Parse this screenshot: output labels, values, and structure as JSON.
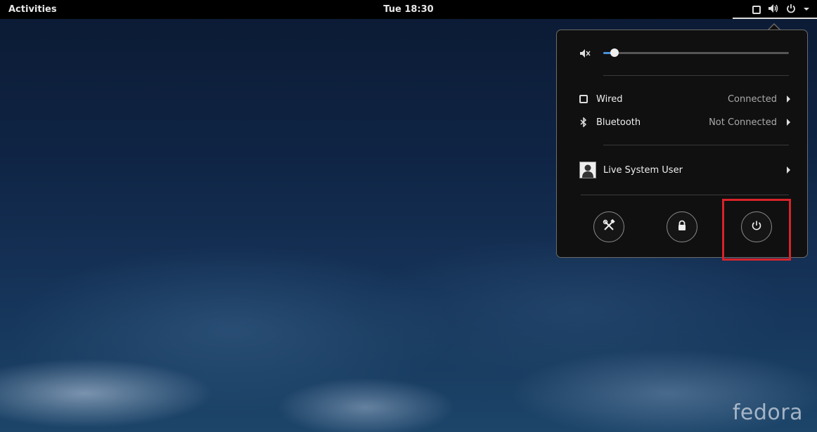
{
  "topbar": {
    "activities_label": "Activities",
    "clock": "Tue 18:30",
    "tray_icons": [
      "network-wired-icon",
      "volume-icon",
      "power-icon",
      "chevron-down-icon"
    ]
  },
  "menu": {
    "volume": {
      "icon": "speaker-muted-icon",
      "level": 0.06
    },
    "wired": {
      "icon": "network-wired-icon",
      "label": "Wired",
      "status": "Connected"
    },
    "bluetooth": {
      "icon": "bluetooth-icon",
      "label": "Bluetooth",
      "status": "Not Connected"
    },
    "user": {
      "icon": "avatar-icon",
      "label": "Live System User"
    },
    "actions": [
      {
        "name": "settings",
        "icon": "tools-icon"
      },
      {
        "name": "lock",
        "icon": "lock-icon"
      },
      {
        "name": "power-off",
        "icon": "power-icon",
        "highlighted": true
      }
    ]
  },
  "highlight_color": "#d8232a",
  "accent_color": "#4a90d9",
  "watermark": "fedora"
}
